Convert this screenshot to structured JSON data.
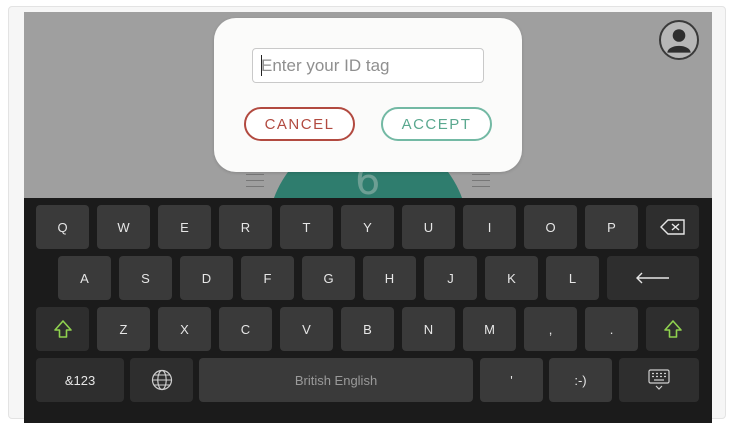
{
  "dialog": {
    "input_placeholder": "Enter your ID tag",
    "input_value": "",
    "cancel_label": "CANCEL",
    "accept_label": "ACCEPT"
  },
  "background": {
    "dial_number": "6"
  },
  "keyboard": {
    "row1": [
      "Q",
      "W",
      "E",
      "R",
      "T",
      "Y",
      "U",
      "I",
      "O",
      "P"
    ],
    "row2": [
      "A",
      "S",
      "D",
      "F",
      "G",
      "H",
      "J",
      "K",
      "L"
    ],
    "row3": [
      "Z",
      "X",
      "C",
      "V",
      "B",
      "N",
      "M",
      ",",
      "."
    ],
    "symbols_label": "&123",
    "space_label": "British English",
    "apostrophe": "'",
    "smiley": ":-)"
  },
  "icons": {
    "avatar": "user-avatar-icon",
    "backspace": "backspace-icon",
    "enter": "enter-icon",
    "shift": "shift-icon",
    "globe": "globe-icon",
    "hide_keyboard": "keyboard-hide-icon"
  },
  "colors": {
    "cancel": "#b24a40",
    "accept": "#73b9a4",
    "shift": "#8fd14f",
    "keyboard_bg": "#1b1b1b",
    "key_bg": "#3a3a3a"
  }
}
